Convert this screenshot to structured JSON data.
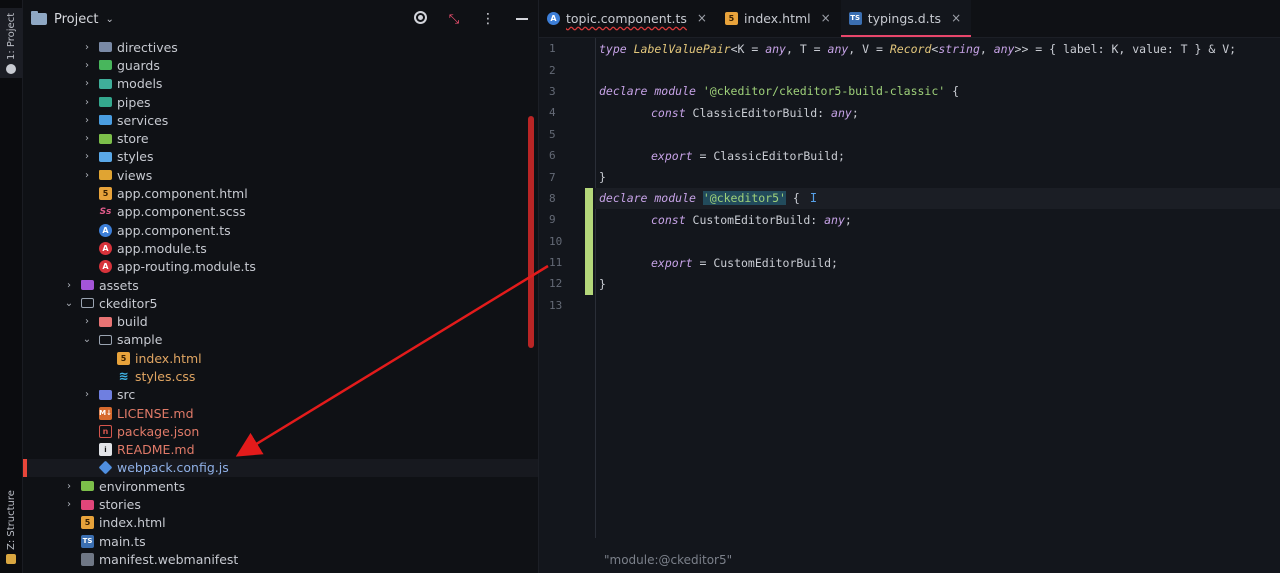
{
  "tool_strip": {
    "project_tab": "1: Project",
    "structure_tab": "Z: Structure"
  },
  "panel": {
    "title": "Project",
    "tools": [
      "locate-icon",
      "collapse-all-icon",
      "options-icon",
      "minimize-icon"
    ]
  },
  "tree": [
    {
      "label": "directives",
      "kind": "folder",
      "color": "#7a8aa6",
      "indent": 58,
      "chev": "›",
      "cls": "t-normal"
    },
    {
      "label": "guards",
      "kind": "folder",
      "color": "#48b65c",
      "indent": 58,
      "chev": "›",
      "cls": "t-normal"
    },
    {
      "label": "models",
      "kind": "folder",
      "color": "#3fae9a",
      "indent": 58,
      "chev": "›",
      "cls": "t-normal"
    },
    {
      "label": "pipes",
      "kind": "folder",
      "color": "#34a88e",
      "indent": 58,
      "chev": "›",
      "cls": "t-normal"
    },
    {
      "label": "services",
      "kind": "folder",
      "color": "#4a9de0",
      "indent": 58,
      "chev": "›",
      "cls": "t-normal"
    },
    {
      "label": "store",
      "kind": "folder",
      "color": "#7cbf4a",
      "indent": 58,
      "chev": "›",
      "cls": "t-normal"
    },
    {
      "label": "styles",
      "kind": "folder",
      "color": "#5aa8e8",
      "indent": 58,
      "chev": "›",
      "cls": "t-normal"
    },
    {
      "label": "views",
      "kind": "folder",
      "color": "#e0a432",
      "indent": 58,
      "chev": "›",
      "cls": "t-normal"
    },
    {
      "label": "app.component.html",
      "kind": "html",
      "indent": 58,
      "chev": "",
      "cls": "t-normal"
    },
    {
      "label": "app.component.scss",
      "kind": "scss",
      "indent": 58,
      "chev": "",
      "cls": "t-normal"
    },
    {
      "label": "app.component.ts",
      "kind": "angular-blue",
      "indent": 58,
      "chev": "",
      "cls": "t-normal"
    },
    {
      "label": "app.module.ts",
      "kind": "angular-red",
      "indent": 58,
      "chev": "",
      "cls": "t-normal"
    },
    {
      "label": "app-routing.module.ts",
      "kind": "angular-red",
      "indent": 58,
      "chev": "",
      "cls": "t-normal"
    },
    {
      "label": "assets",
      "kind": "folder",
      "color": "#a455d8",
      "indent": 40,
      "chev": "›",
      "cls": "t-normal"
    },
    {
      "label": "ckeditor5",
      "kind": "open",
      "indent": 40,
      "chev": "⌄",
      "cls": "t-normal"
    },
    {
      "label": "build",
      "kind": "folder",
      "color": "#e87474",
      "indent": 58,
      "chev": "›",
      "cls": "t-normal"
    },
    {
      "label": "sample",
      "kind": "open",
      "indent": 58,
      "chev": "⌄",
      "cls": "t-normal"
    },
    {
      "label": "index.html",
      "kind": "html",
      "indent": 76,
      "chev": "",
      "cls": "t-orange"
    },
    {
      "label": "styles.css",
      "kind": "css",
      "indent": 76,
      "chev": "",
      "cls": "t-orange"
    },
    {
      "label": "src",
      "kind": "folder",
      "color": "#6f7fe0",
      "indent": 58,
      "chev": "›",
      "cls": "t-normal"
    },
    {
      "label": "LICENSE.md",
      "kind": "md-license",
      "indent": 58,
      "chev": "",
      "cls": "t-red"
    },
    {
      "label": "package.json",
      "kind": "json",
      "indent": 58,
      "chev": "",
      "cls": "t-red"
    },
    {
      "label": "README.md",
      "kind": "md-readme",
      "indent": 58,
      "chev": "",
      "cls": "t-red"
    },
    {
      "label": "webpack.config.js",
      "kind": "webpack",
      "indent": 58,
      "chev": "",
      "cls": "t-blue",
      "selected": true
    },
    {
      "label": "environments",
      "kind": "folder",
      "color": "#7cbf4a",
      "indent": 40,
      "chev": "›",
      "cls": "t-normal"
    },
    {
      "label": "stories",
      "kind": "folder",
      "color": "#e0467a",
      "indent": 40,
      "chev": "›",
      "cls": "t-normal"
    },
    {
      "label": "index.html",
      "kind": "html",
      "indent": 40,
      "chev": "",
      "cls": "t-normal"
    },
    {
      "label": "main.ts",
      "kind": "ts",
      "indent": 40,
      "chev": "",
      "cls": "t-normal"
    },
    {
      "label": "manifest.webmanifest",
      "kind": "manifest",
      "indent": 40,
      "chev": "",
      "cls": "t-normal"
    }
  ],
  "tabs": [
    {
      "label": "topic.component.ts",
      "icon": "angular-icon",
      "squiggle": true,
      "active": false
    },
    {
      "label": "index.html",
      "icon": "html5-icon",
      "squiggle": false,
      "active": false
    },
    {
      "label": "typings.d.ts",
      "icon": "typescript-icon",
      "squiggle": false,
      "active": true
    }
  ],
  "tab_close": "×",
  "line_numbers": [
    "1",
    "2",
    "3",
    "4",
    "5",
    "6",
    "7",
    "8",
    "9",
    "10",
    "11",
    "12",
    "13"
  ],
  "code": {
    "l1": [
      "type ",
      "LabelValuePair",
      "<K = ",
      "any",
      ", T = ",
      "any",
      ", V = ",
      "Record",
      "<",
      "string",
      ", ",
      "any",
      ">> = { label: K, value: T } & V;"
    ],
    "l3": [
      "declare module ",
      "'@ckeditor/ckeditor5-build-classic'",
      " {"
    ],
    "l4": [
      "const ",
      "ClassicEditorBuild: ",
      "any",
      ";"
    ],
    "l6": [
      "export ",
      "= ClassicEditorBuild;"
    ],
    "l7": "}",
    "l8": [
      "declare module ",
      "'@ckeditor5'",
      " {"
    ],
    "l9": [
      "const ",
      "CustomEditorBuild: ",
      "any",
      ";"
    ],
    "l11": [
      "export ",
      "= CustomEditorBuild;"
    ],
    "l12": "}"
  },
  "status_text": "\"module:@ckeditor5\"",
  "accent": "#e8466b",
  "arrow_color": "#e31b1b"
}
